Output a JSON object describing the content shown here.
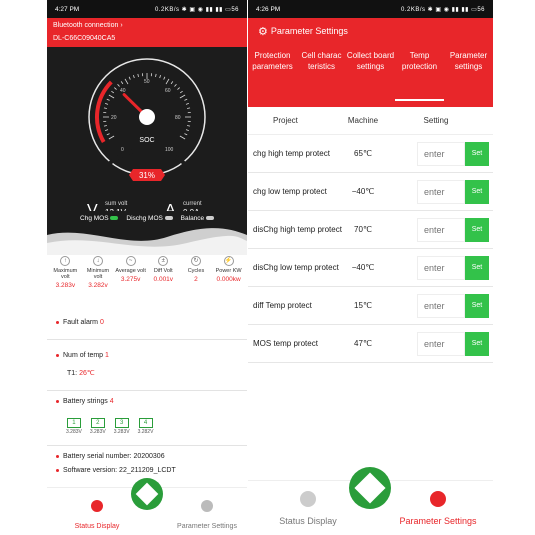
{
  "left": {
    "status": {
      "time": "4:27 PM",
      "speed": "0.2KB/s",
      "icons": "✱ ▣ ◉ ▮▮ ▮▮ ▭56"
    },
    "header": {
      "bluetooth": "Bluetooth connection ›",
      "device": "DL-C66C09040CA5"
    },
    "gauge": {
      "ticks": [
        "0",
        "20",
        "40",
        "50",
        "60",
        "80",
        "100"
      ],
      "center_label": "SOC",
      "percent": "31%",
      "level": 0.31
    },
    "sum_volt": {
      "label": "sum volt",
      "value": "13.1V"
    },
    "current": {
      "label": "current",
      "value": "0.0A"
    },
    "toggles": {
      "chg": "Chg MOS",
      "dischg": "Dischg MOS",
      "balance": "Balance"
    },
    "stats": [
      {
        "label": "Maximum volt",
        "value": "3.283v"
      },
      {
        "label": "Minimum volt",
        "value": "3.282v"
      },
      {
        "label": "Average volt",
        "value": "3.275v"
      },
      {
        "label": "Diff Volt",
        "value": "0.001v"
      },
      {
        "label": "Cycles",
        "value": "2"
      },
      {
        "label": "Power KW",
        "value": "0.000kw"
      }
    ],
    "fault": {
      "label": "Fault alarm",
      "value": "0"
    },
    "temp": {
      "label": "Num of temp",
      "value": "1",
      "t1_label": "T1:",
      "t1_value": "26℃"
    },
    "battery": {
      "label": "Battery strings",
      "value": "4",
      "cells": [
        {
          "num": "1",
          "volt": "3.283V"
        },
        {
          "num": "2",
          "volt": "3.283V"
        },
        {
          "num": "3",
          "volt": "3.283V"
        },
        {
          "num": "4",
          "volt": "3.282V"
        }
      ]
    },
    "serial": {
      "label": "Battery serial number:",
      "value": "20200306"
    },
    "software": {
      "label": "Software version:",
      "value": "22_211209_LCDT"
    },
    "nav": {
      "status": "Status Display",
      "params": "Parameter Settings"
    }
  },
  "right": {
    "status": {
      "time": "4:26 PM",
      "speed": "0.2KB/s",
      "icons": "✱ ▣ ◉ ▮▮ ▮▮ ▭56"
    },
    "title": "Parameter Settings",
    "tabs": [
      "Protection parameters",
      "Cell charac teristics",
      "Collect board settings",
      "Temp protection",
      "Parameter settings"
    ],
    "columns": {
      "project": "Project",
      "machine": "Machine",
      "setting": "Setting"
    },
    "rows": [
      {
        "name": "chg high temp protect",
        "value": "65℃"
      },
      {
        "name": "chg low temp protect",
        "value": "−40℃"
      },
      {
        "name": "disChg high temp protect",
        "value": "70℃"
      },
      {
        "name": "disChg low temp protect",
        "value": "−40℃"
      },
      {
        "name": "diff Temp protect",
        "value": "15℃"
      },
      {
        "name": "MOS temp protect",
        "value": "47℃"
      }
    ],
    "placeholder": "enter",
    "set_label": "Set",
    "nav": {
      "status": "Status Display",
      "params": "Parameter Settings"
    }
  },
  "colors": {
    "accent": "#e8262a",
    "green": "#33c24a",
    "dark": "#1c1c1c"
  }
}
